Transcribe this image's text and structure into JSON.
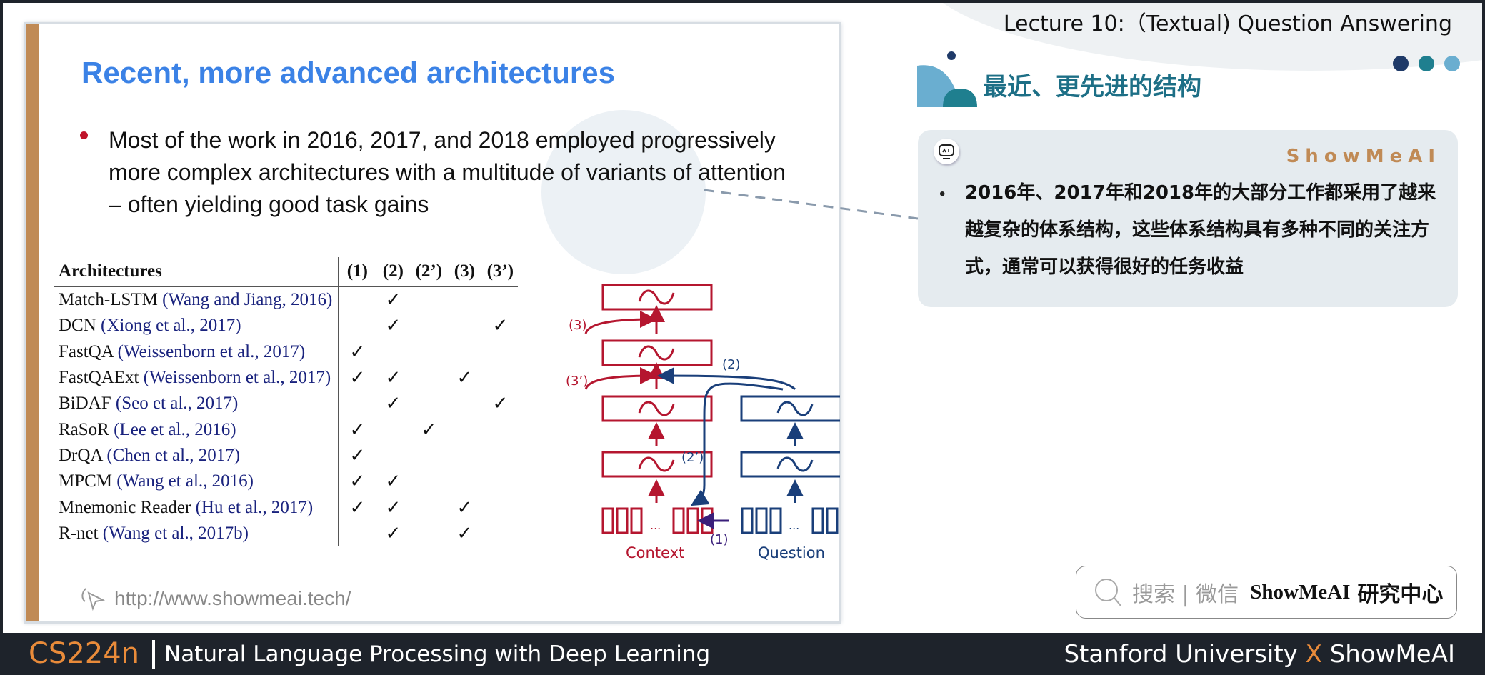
{
  "header": {
    "lecture_title": "Lecture 10:（Textual) Question Answering",
    "cn_section_title": "最近、更先进的结构",
    "decor_dot_colors": [
      "#1f3a68",
      "#1f7f8f",
      "#6aaed0"
    ]
  },
  "slide": {
    "title": "Recent, more advanced architectures",
    "bullet": "Most of the work in 2016, 2017, and 2018 employed progressively more complex architectures with a multitude of variants of attention – often yielding good task gains",
    "accent_color": "#c08a55",
    "title_color": "#3b82e6",
    "url": "http://www.showmeai.tech/",
    "table": {
      "header": [
        "Architectures",
        "(1)",
        "(2)",
        "(2’)",
        "(3)",
        "(3’)"
      ],
      "check_glyph": "✓",
      "rows": [
        {
          "name": "Match-LSTM",
          "cite": "(Wang and Jiang, 2016)",
          "checks": [
            "",
            "✓",
            "",
            "",
            ""
          ]
        },
        {
          "name": "DCN",
          "cite": "(Xiong et al., 2017)",
          "checks": [
            "",
            "✓",
            "",
            "",
            "✓"
          ]
        },
        {
          "name": "FastQA",
          "cite": "(Weissenborn et al., 2017)",
          "checks": [
            "✓",
            "",
            "",
            "",
            ""
          ]
        },
        {
          "name": "FastQAExt",
          "cite": "(Weissenborn et al., 2017)",
          "checks": [
            "✓",
            "✓",
            "",
            "✓",
            ""
          ]
        },
        {
          "name": "BiDAF",
          "cite": "(Seo et al., 2017)",
          "checks": [
            "",
            "✓",
            "",
            "",
            "✓"
          ]
        },
        {
          "name": "RaSoR",
          "cite": "(Lee et al., 2016)",
          "checks": [
            "✓",
            "",
            "✓",
            "",
            ""
          ]
        },
        {
          "name": "DrQA",
          "cite": "(Chen et al., 2017)",
          "checks": [
            "✓",
            "",
            "",
            "",
            ""
          ]
        },
        {
          "name": "MPCM",
          "cite": "(Wang et al., 2016)",
          "checks": [
            "✓",
            "✓",
            "",
            "",
            ""
          ]
        },
        {
          "name": "Mnemonic Reader",
          "cite": "(Hu et al., 2017)",
          "checks": [
            "✓",
            "✓",
            "",
            "✓",
            ""
          ]
        },
        {
          "name": "R-net",
          "cite": "(Wang et al., 2017b)",
          "checks": [
            "",
            "✓",
            "",
            "✓",
            ""
          ]
        }
      ]
    },
    "diagram": {
      "context_label": "Context",
      "question_label": "Question",
      "labels": {
        "l1": "(1)",
        "l2": "(2)",
        "l2p": "(2’)",
        "l3": "(3)",
        "l3p": "(3’)"
      },
      "ellipsis": "...",
      "context_color": "#b5162f",
      "question_color": "#1a3f7a"
    }
  },
  "card": {
    "brand": "ShowMeAI",
    "bullet": "•",
    "text": "2016年、2017年和2018年的大部分工作都采用了越来越复杂的体系结构，这些体系结构具有多种不同的关注方式，通常可以获得很好的任务收益"
  },
  "search": {
    "hint": "搜索 | 微信",
    "brand": "ShowMeAI",
    "suffix": "研究中心"
  },
  "footer": {
    "course_code": "CS224n",
    "course_name": "Natural Language Processing with Deep Learning",
    "partner_left": "Stanford University",
    "partner_x": "X",
    "partner_right": "ShowMeAI"
  }
}
